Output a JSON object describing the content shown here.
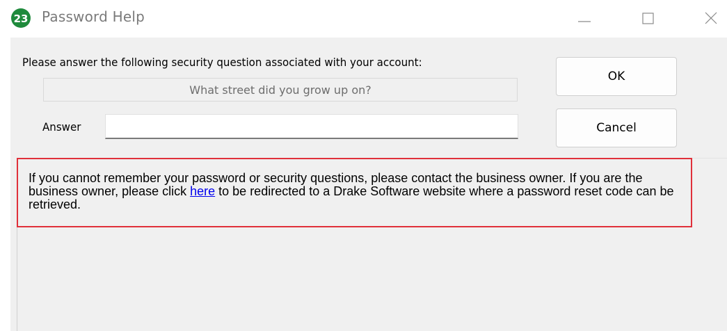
{
  "window": {
    "title": "Password Help",
    "icon_label": "23",
    "icon_color": "#1f8a3c",
    "controls": {
      "minimize": "minimize-icon",
      "maximize": "maximize-icon",
      "close": "close-icon"
    }
  },
  "form": {
    "prompt": "Please answer the following security question associated with your account:",
    "question": "What street did you grow up on?",
    "answer_label": "Answer",
    "answer_value": ""
  },
  "buttons": {
    "ok": "OK",
    "cancel": "Cancel"
  },
  "info": {
    "text_before_link": "If you cannot remember your password or security questions, please contact the business owner. If you are the business owner, please click ",
    "link_text": "here",
    "text_after_link": " to be redirected to a Drake Software website where a password reset code can be retrieved.",
    "highlight_color": "#e0303a",
    "link_color": "#0000ee"
  }
}
